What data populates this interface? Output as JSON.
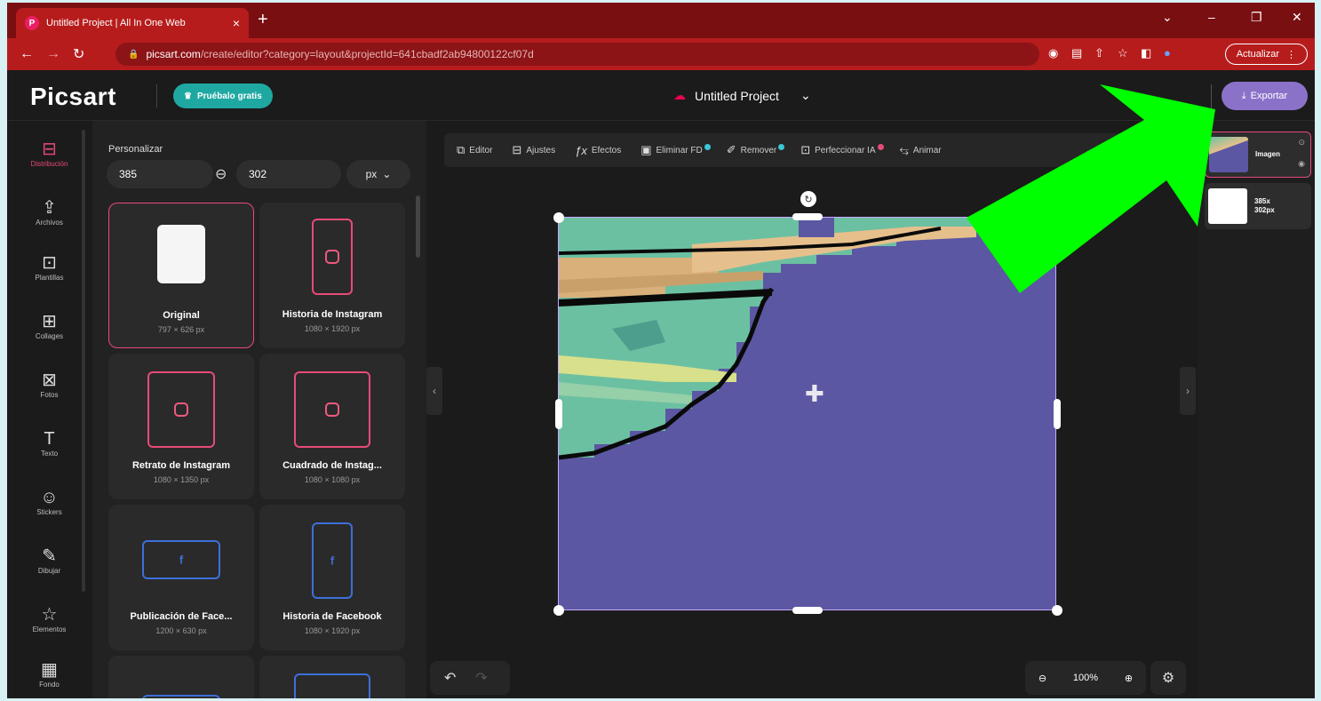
{
  "browser": {
    "tab_title": "Untitled Project | All In One Web",
    "tab_close": "×",
    "new_tab": "+",
    "url_host": "picsart.com",
    "url_path": "/create/editor?category=layout&projectId=641cbadf2ab94800122cf07d",
    "update_label": "Actualizar",
    "window_controls": [
      "⌄",
      "–",
      "❐",
      "✕"
    ]
  },
  "header": {
    "logo": "Picsart",
    "try_label": "Pruébalo gratis",
    "project_name": "Untitled Project",
    "export_label": "Exportar"
  },
  "rail": [
    {
      "label": "Distribución",
      "icon": "layout-icon",
      "glyph": "⊟",
      "active": true
    },
    {
      "label": "Archivos",
      "icon": "upload-icon",
      "glyph": "⇪"
    },
    {
      "label": "Plantillas",
      "icon": "templates-icon",
      "glyph": "⊡"
    },
    {
      "label": "Collages",
      "icon": "collage-icon",
      "glyph": "⊞"
    },
    {
      "label": "Fotos",
      "icon": "photo-icon",
      "glyph": "⊠"
    },
    {
      "label": "Texto",
      "icon": "text-icon",
      "glyph": "T"
    },
    {
      "label": "Stickers",
      "icon": "sticker-icon",
      "glyph": "☺"
    },
    {
      "label": "Dibujar",
      "icon": "brush-icon",
      "glyph": "✎"
    },
    {
      "label": "Elementos",
      "icon": "star-icon",
      "glyph": "☆"
    },
    {
      "label": "Fondo",
      "icon": "background-icon",
      "glyph": "▦"
    }
  ],
  "panel": {
    "title": "Personalizar",
    "width": "385",
    "height": "302",
    "unit": "px",
    "cards": [
      {
        "name": "Original",
        "size": "797 × 626 px",
        "kind": "original",
        "selected": true
      },
      {
        "name": "Historia de Instagram",
        "size": "1080 × 1920 px",
        "kind": "ig-story"
      },
      {
        "name": "Retrato de Instagram",
        "size": "1080 × 1350 px",
        "kind": "ig-portrait"
      },
      {
        "name": "Cuadrado de Instag...",
        "size": "1080 × 1080 px",
        "kind": "ig-square"
      },
      {
        "name": "Publicación de Face...",
        "size": "1200 × 630 px",
        "kind": "fb-post"
      },
      {
        "name": "Historia de Facebook",
        "size": "1080 × 1920 px",
        "kind": "fb-story"
      }
    ]
  },
  "toolbar": [
    {
      "label": "Editor",
      "icon": "editor-icon",
      "glyph": "⧉"
    },
    {
      "label": "Ajustes",
      "icon": "adjust-icon",
      "glyph": "⊟"
    },
    {
      "label": "Efectos",
      "icon": "fx-icon",
      "glyph": "ƒx"
    },
    {
      "label": "Eliminar FD",
      "icon": "remove-bg-icon",
      "glyph": "▣",
      "dot": "teal"
    },
    {
      "label": "Remover",
      "icon": "eraser-icon",
      "glyph": "✐",
      "dot": "teal"
    },
    {
      "label": "Perfeccionar IA",
      "icon": "ai-enhance-icon",
      "glyph": "⊡",
      "dot": "pink"
    },
    {
      "label": "Animar",
      "icon": "animate-icon",
      "glyph": "⥃"
    }
  ],
  "zoom": {
    "level": "100%"
  },
  "layers": [
    {
      "name": "Imagen",
      "selected": true
    },
    {
      "name": "385x 302px"
    }
  ],
  "colors": {
    "accent": "#e84a78",
    "canvas": "#5b57a2",
    "arrow": "#00ff00",
    "export": "#8b72c9",
    "teal": "#1fa8a2"
  }
}
